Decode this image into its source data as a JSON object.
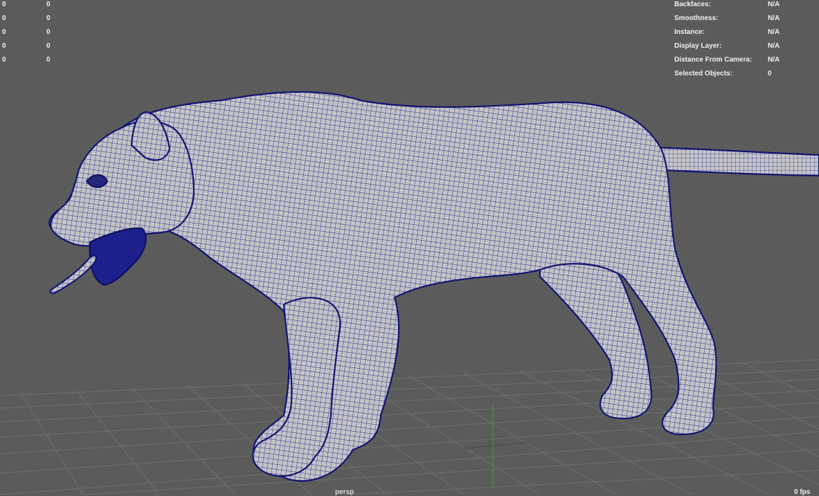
{
  "hud_left": {
    "rows": [
      {
        "a": "0",
        "b": "0"
      },
      {
        "a": "0",
        "b": "0"
      },
      {
        "a": "0",
        "b": "0"
      },
      {
        "a": "0",
        "b": "0"
      },
      {
        "a": "0",
        "b": "0"
      }
    ]
  },
  "hud_right": {
    "rows": [
      {
        "label": "Backfaces:",
        "value": "N/A"
      },
      {
        "label": "Smoothness:",
        "value": "N/A"
      },
      {
        "label": "Instance:",
        "value": "N/A"
      },
      {
        "label": "Display Layer:",
        "value": "N/A"
      },
      {
        "label": "Distance From Camera:",
        "value": "N/A"
      },
      {
        "label": "Selected Objects:",
        "value": "0"
      }
    ]
  },
  "viewport": {
    "camera_label": "persp",
    "fps_label": "0 fps",
    "background_color": "#5b5b5b",
    "grid_color": "#6e6e6e",
    "wire_color": "#1c1f8c",
    "mesh_color": "#c4c4c6",
    "axis_y_color": "#3f8f47",
    "model_icon": "panther-wireframe-model"
  }
}
